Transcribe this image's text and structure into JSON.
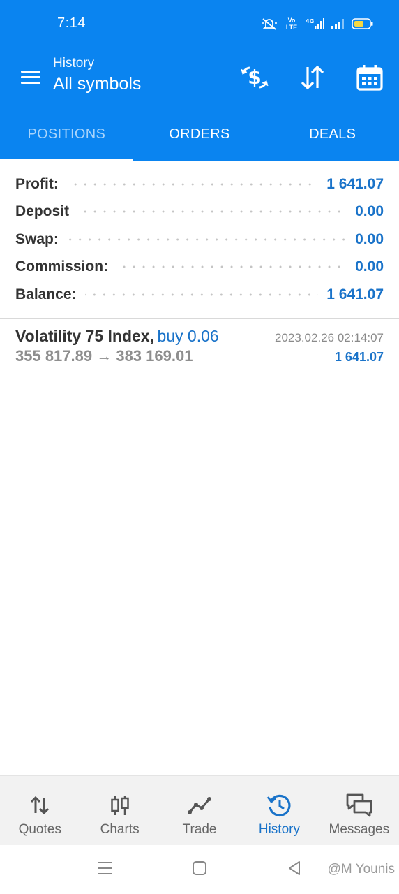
{
  "status_bar": {
    "time": "7:14",
    "volte": "Vo LTE",
    "network": "4G"
  },
  "app_bar": {
    "subtitle": "History",
    "title": "All symbols",
    "icons": [
      "menu-icon",
      "dollar-refresh-icon",
      "sort-arrows-icon",
      "calendar-icon"
    ]
  },
  "tabs": [
    {
      "label": "POSITIONS",
      "active": true
    },
    {
      "label": "ORDERS",
      "active": false
    },
    {
      "label": "DEALS",
      "active": false
    }
  ],
  "summary": {
    "profit_label": "Profit:",
    "profit_value": "1 641.07",
    "deposit_label": "Deposit",
    "deposit_value": "0.00",
    "swap_label": "Swap:",
    "swap_value": "0.00",
    "commission_label": "Commission:",
    "commission_value": "0.00",
    "balance_label": "Balance:",
    "balance_value": "1 641.07"
  },
  "deals": [
    {
      "symbol": "Volatility 75 Index,",
      "type": "buy 0.06",
      "time": "2023.02.26 02:14:07",
      "prices": "355 817.89 → 383 169.01",
      "profit": "1 641.07"
    }
  ],
  "bottom_nav": [
    {
      "label": "Quotes",
      "icon": "quotes-arrows-icon"
    },
    {
      "label": "Charts",
      "icon": "candlestick-icon"
    },
    {
      "label": "Trade",
      "icon": "trade-line-icon"
    },
    {
      "label": "History",
      "icon": "history-clock-icon",
      "active": true
    },
    {
      "label": "Messages",
      "icon": "chat-bubbles-icon"
    }
  ],
  "watermark": "@M Younis",
  "colors": {
    "header_blue": "#0a84f0",
    "value_blue": "#1a73c9",
    "active_tab": "#a8d4fb"
  }
}
